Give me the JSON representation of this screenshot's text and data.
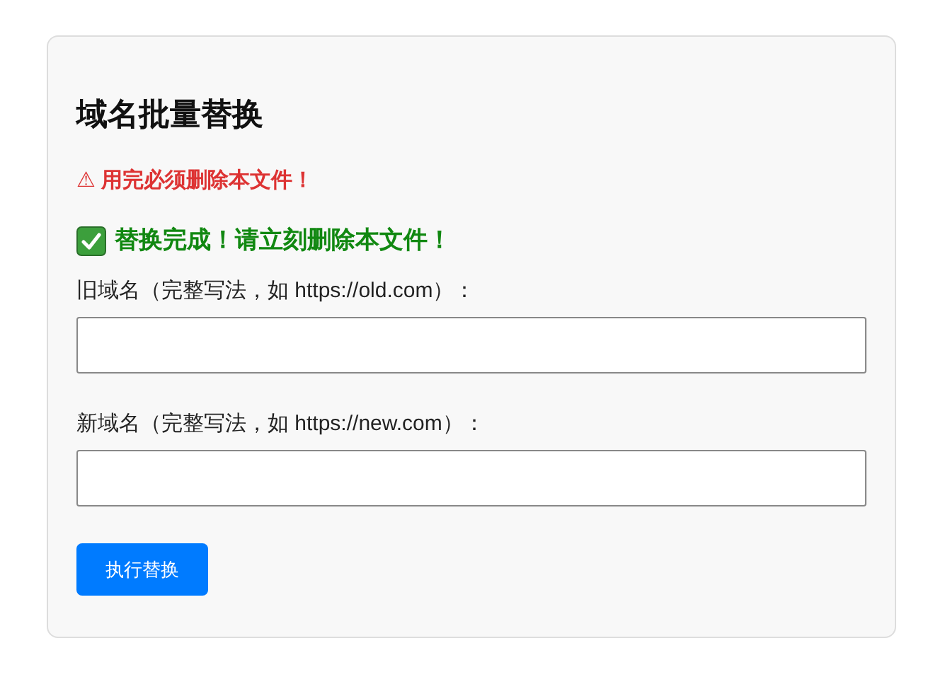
{
  "title": "域名批量替换",
  "warning": "⚠ 用完必须删除本文件！",
  "success": "替换完成！请立刻删除本文件！",
  "fields": [
    {
      "label": "旧域名（完整写法，如 https://old.com）："
    },
    {
      "label": "新域名（完整写法，如 https://new.com）："
    }
  ],
  "button": "执行替换"
}
